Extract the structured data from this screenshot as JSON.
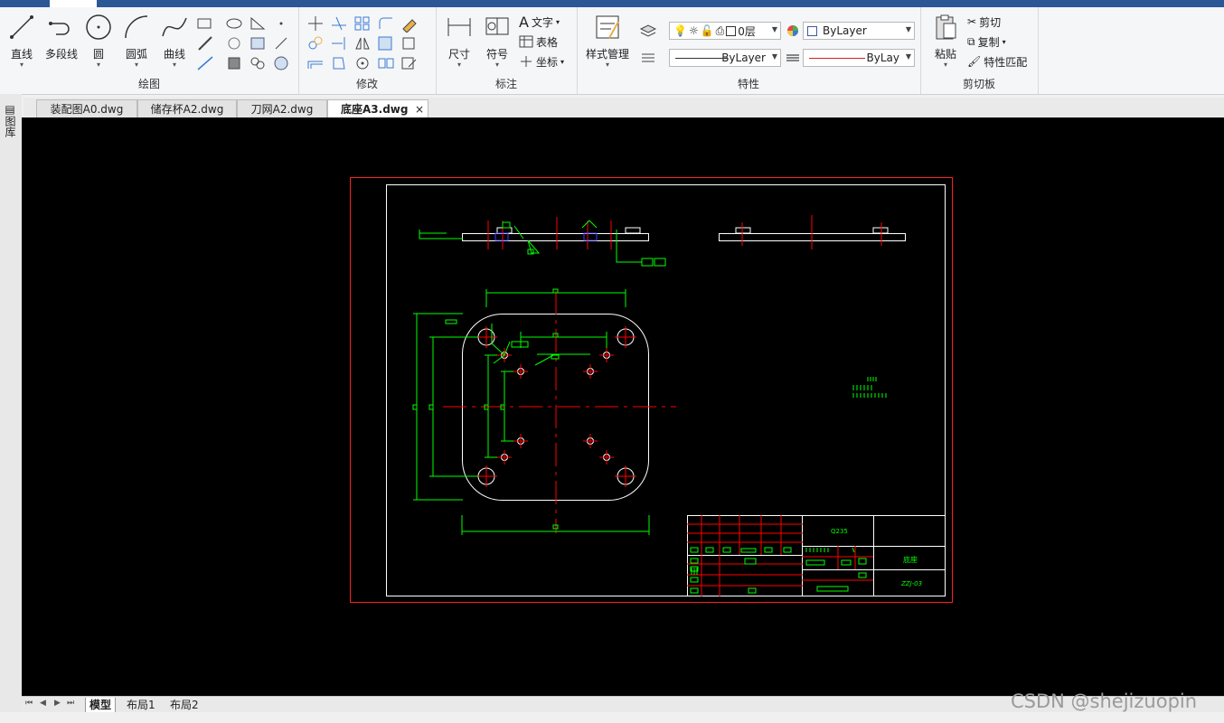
{
  "ribbon": {
    "draw": {
      "label": "绘图",
      "line": "直线",
      "polyline": "多段线",
      "circle": "圆",
      "arc": "圆弧",
      "curve": "曲线"
    },
    "modify": {
      "label": "修改"
    },
    "annotation": {
      "label": "标注",
      "dimension": "尺寸",
      "symbol": "符号",
      "text": "文字",
      "table": "表格",
      "coordinate": "坐标"
    },
    "properties": {
      "label": "特性",
      "style_manager": "样式管理",
      "layer_value": "0层",
      "color_value": "ByLayer",
      "linetype_value": "ByLayer",
      "lineweight_value": "ByLay"
    },
    "clipboard": {
      "label": "剪切板",
      "paste": "粘贴",
      "cut": "剪切",
      "copy": "复制",
      "match": "特性匹配"
    }
  },
  "left_strip": {
    "label": "图库"
  },
  "doc_tabs": [
    {
      "label": "装配图A0.dwg"
    },
    {
      "label": "储存杯A2.dwg"
    },
    {
      "label": "刀网A2.dwg"
    },
    {
      "label": "底座A3.dwg",
      "close": "×"
    }
  ],
  "layout_tabs": [
    {
      "label": "模型"
    },
    {
      "label": "布局1"
    },
    {
      "label": "布局2"
    }
  ],
  "drawing": {
    "material": "Q235",
    "part_name": "底座",
    "drawing_no": "ZZJ-03"
  },
  "watermark": "CSDN @shejizuopin",
  "colors": {
    "canvas": "#000000",
    "frame": "#ff2020",
    "geometry": "#ffffff",
    "dimension": "#00ff00",
    "centerline": "#ff0000",
    "ribbon_top": "#2b5797"
  }
}
